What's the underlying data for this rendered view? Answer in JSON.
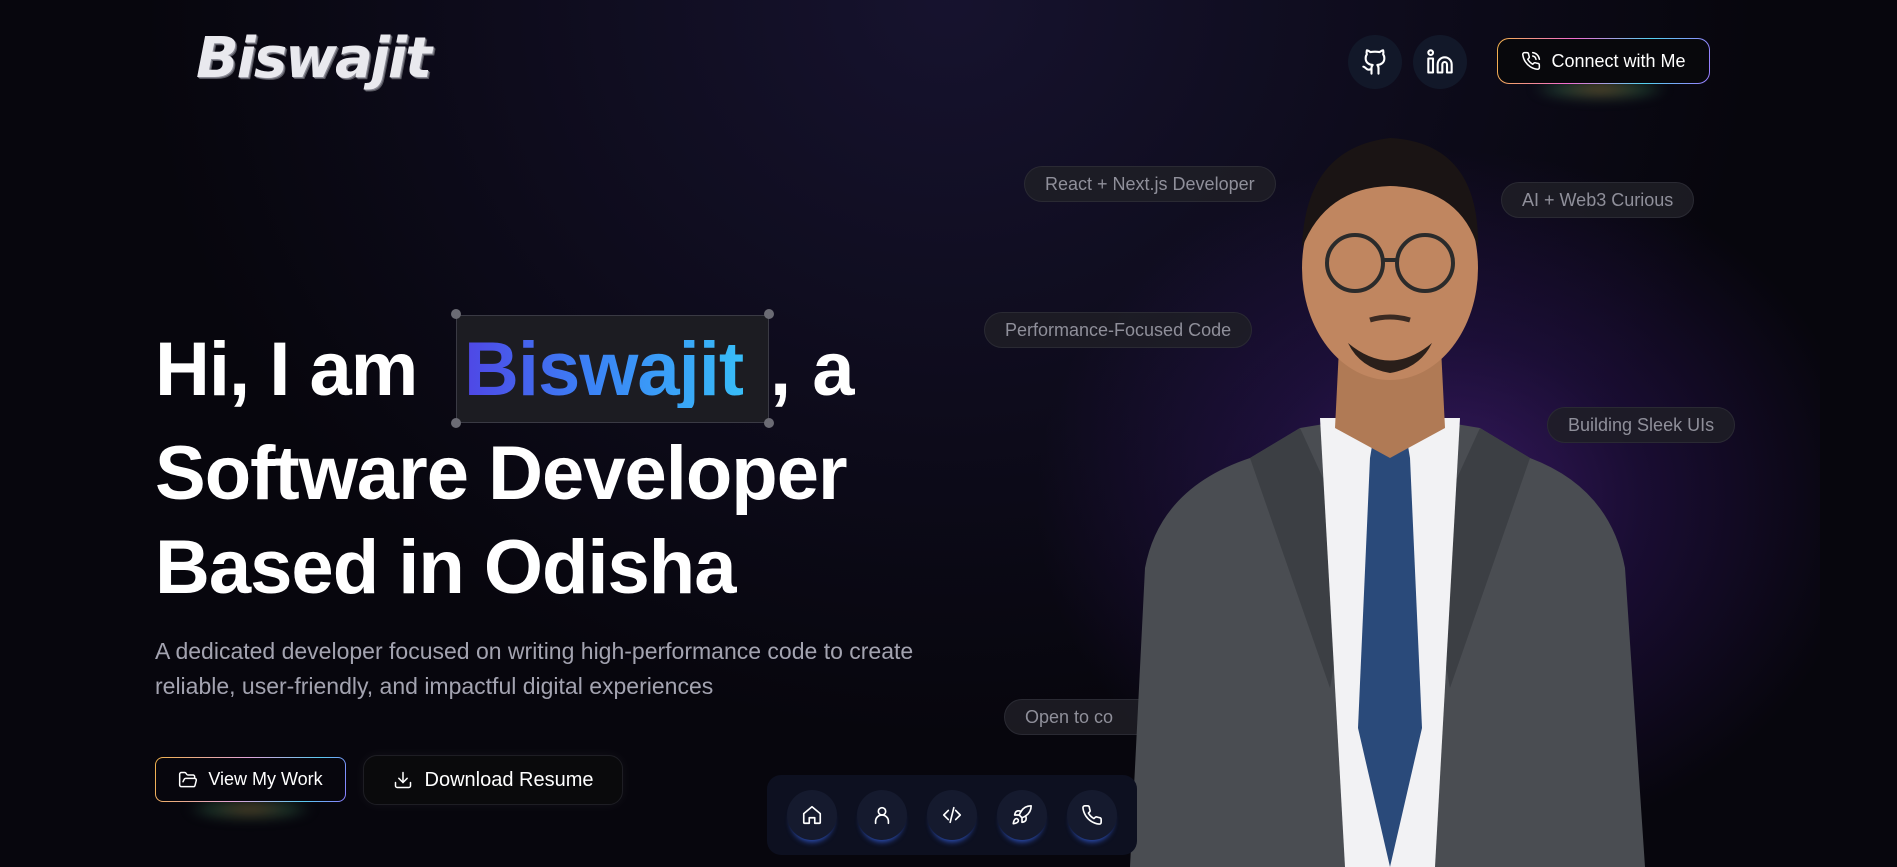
{
  "header": {
    "logo": "Biswajit",
    "github_icon": "github-icon",
    "linkedin_icon": "linkedin-icon",
    "connect_label": "Connect with Me"
  },
  "hero": {
    "line1_prefix": "Hi, I am",
    "name": "Biswajit",
    "line1_suffix": ", a",
    "line2": "Software Developer",
    "line3": "Based in Odisha",
    "subtitle": "A dedicated developer focused on writing high-performance code to create reliable, user-friendly, and impactful digital experiences",
    "view_work_label": "View My Work",
    "download_resume_label": "Download Resume"
  },
  "chips": {
    "react": "React + Next.js Developer",
    "ai": "AI + Web3 Curious",
    "performance": "Performance-Focused Code",
    "ui": "Building Sleek UIs",
    "open": "Open to co"
  },
  "bottom_nav": {
    "items": [
      "home-icon",
      "user-icon",
      "code-icon",
      "rocket-icon",
      "phone-icon"
    ]
  },
  "colors": {
    "background": "#07060d",
    "name_gradient_start": "#4f46e5",
    "name_gradient_end": "#38bdf8",
    "nav_bg": "#0d1020"
  }
}
